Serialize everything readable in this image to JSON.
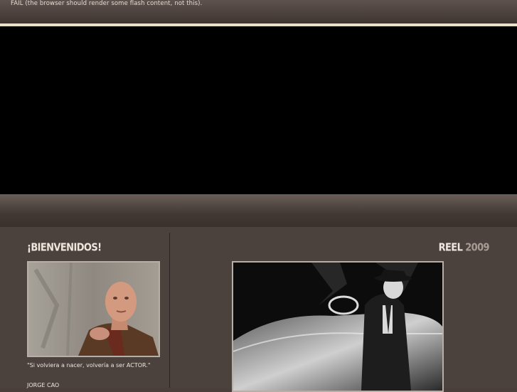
{
  "header": {
    "fail_message": "FAIL (the browser should render some flash content, not this)."
  },
  "welcome": {
    "title": "¡BIENVENIDOS!",
    "quote": "\"Si volviera a nacer, volvería a ser ACTOR.\"",
    "author": "JORGE CAO"
  },
  "reel": {
    "label": "REEL",
    "year": "2009"
  },
  "colors": {
    "background": "#4a3f3b",
    "accent_line": "#eadfcb",
    "text": "#efe6dd",
    "muted": "#a89d95"
  }
}
